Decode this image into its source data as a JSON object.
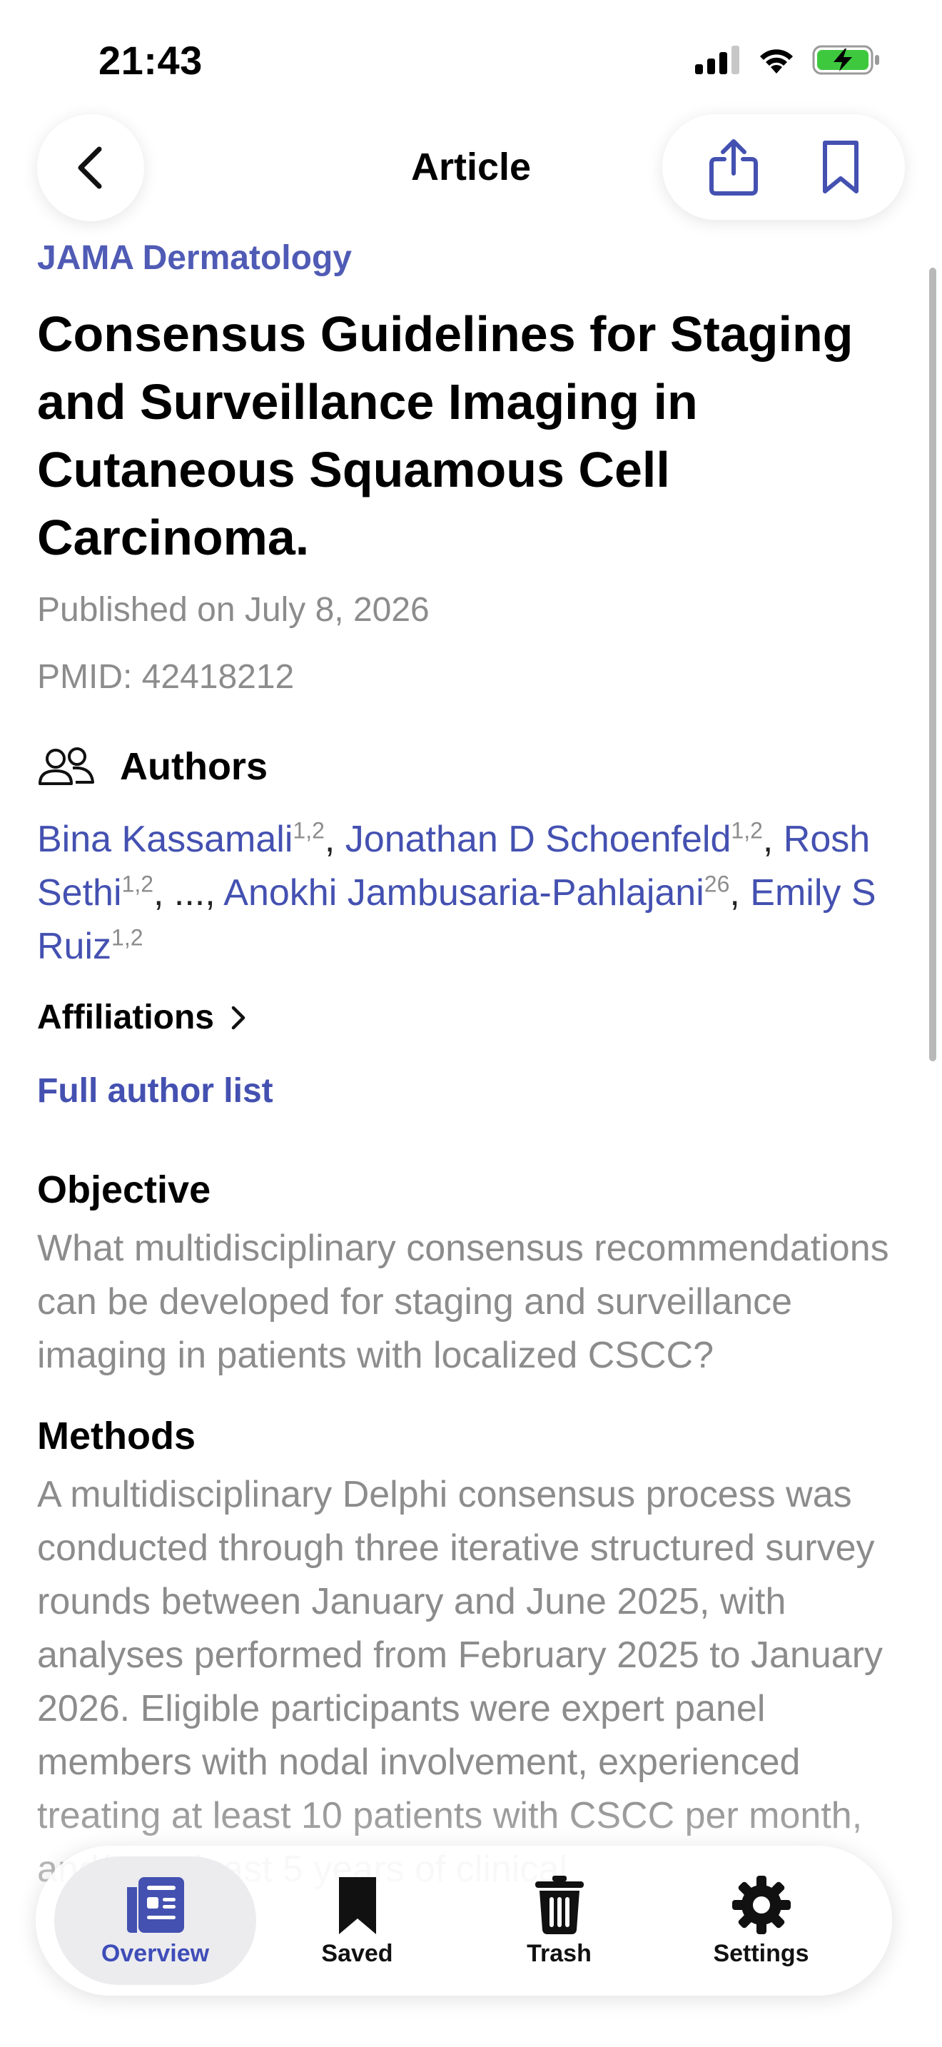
{
  "status": {
    "time": "21:43"
  },
  "header": {
    "title": "Article"
  },
  "article": {
    "journal": "JAMA Dermatology",
    "title": "Consensus Guidelines for Staging and Surveillance Imaging in Cutaneous Squamous Cell Carcinoma.",
    "published": "Published on July 8, 2026",
    "pmid": "PMID: 42418212",
    "authors_heading": "Authors",
    "authors": [
      {
        "name": "Bina Kassamali",
        "sup": "1,2",
        "sep": ", "
      },
      {
        "name": "Jonathan D Schoenfeld",
        "sup": "1,2",
        "sep": ", "
      },
      {
        "name": "Rosh Sethi",
        "sup": "1,2",
        "sep": ", ..., "
      },
      {
        "name": "Anokhi Jambusaria-Pahlajani",
        "sup": "26",
        "sep": ", "
      },
      {
        "name": "Emily S Ruiz",
        "sup": "1,2",
        "sep": ""
      }
    ],
    "affiliations_label": "Affiliations",
    "full_author_list_label": "Full author list",
    "sections": [
      {
        "heading": "Objective",
        "text": "What multidisciplinary consensus recommendations can be developed for staging and surveillance imaging in patients with localized CSCC?"
      },
      {
        "heading": "Methods",
        "text": "A multidisciplinary Delphi consensus process was conducted through three iterative structured survey rounds between January and June 2025, with analyses performed from February 2025 to January 2026. Eligible participants were expert panel members with nodal involvement, experienced treating at least 10 patients with CSCC per month, and/or at least 5 years of clinical"
      }
    ]
  },
  "tabbar": {
    "tabs": [
      {
        "label": "Overview",
        "icon": "overview-icon",
        "active": true
      },
      {
        "label": "Saved",
        "icon": "bookmark-icon",
        "active": false
      },
      {
        "label": "Trash",
        "icon": "trash-icon",
        "active": false
      },
      {
        "label": "Settings",
        "icon": "gear-icon",
        "active": false
      }
    ]
  },
  "colors": {
    "accent": "#4451b1",
    "secondary_text": "#8c8c8c",
    "battery": "#3ec83e"
  }
}
